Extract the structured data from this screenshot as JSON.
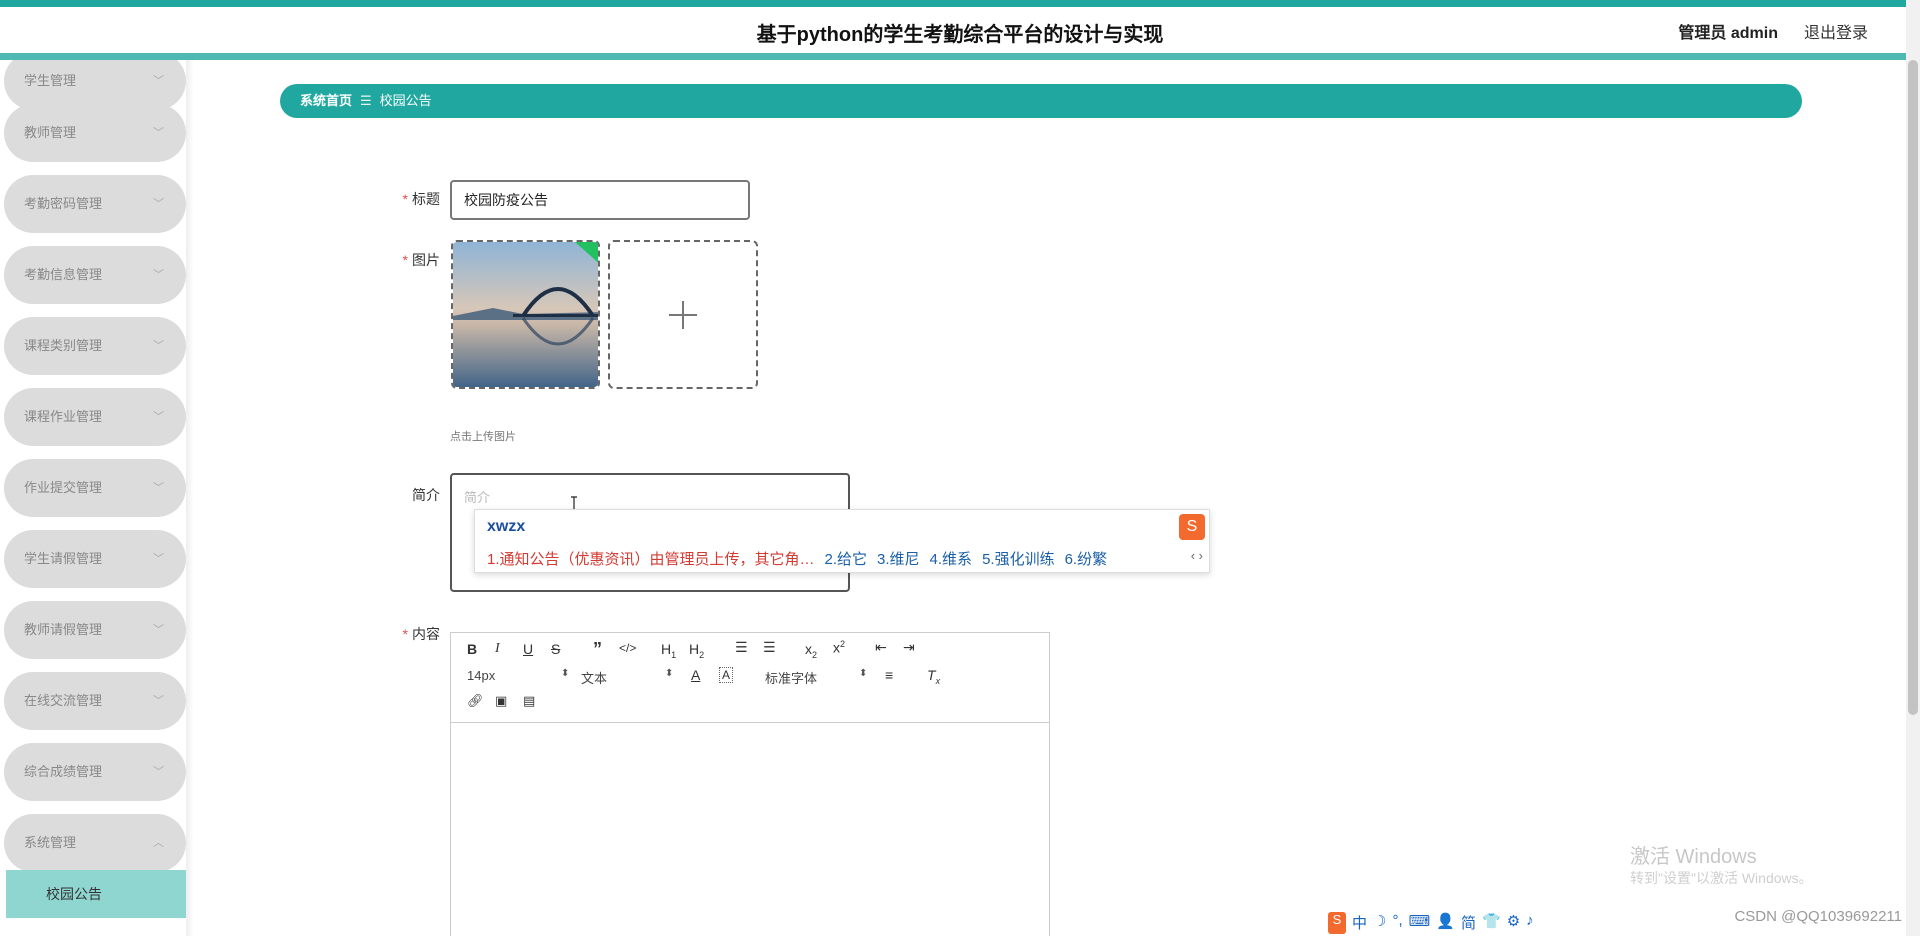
{
  "header": {
    "title": "基于python的学生考勤综合平台的设计与实现",
    "user": "管理员 admin",
    "logout": "退出登录"
  },
  "sidebar": {
    "items": [
      {
        "label": "学生管理"
      },
      {
        "label": "教师管理"
      },
      {
        "label": "考勤密码管理"
      },
      {
        "label": "考勤信息管理"
      },
      {
        "label": "课程类别管理"
      },
      {
        "label": "课程作业管理"
      },
      {
        "label": "作业提交管理"
      },
      {
        "label": "学生请假管理"
      },
      {
        "label": "教师请假管理"
      },
      {
        "label": "在线交流管理"
      },
      {
        "label": "综合成绩管理"
      },
      {
        "label": "系统管理"
      }
    ],
    "active_sub": "校园公告"
  },
  "breadcrumb": {
    "home": "系统首页",
    "sep": "☰",
    "current": "校园公告"
  },
  "form": {
    "title_label": "标题",
    "title_value": "校园防疫公告",
    "image_label": "图片",
    "upload_hint": "点击上传图片",
    "intro_label": "简介",
    "intro_placeholder": "简介",
    "content_label": "内容"
  },
  "ime": {
    "input": "xwzx",
    "candidates": [
      "1.通知公告（优惠资讯）由管理员上传，其它角…",
      "2.给它",
      "3.维尼",
      "4.维系",
      "5.强化训练",
      "6.纷繁"
    ],
    "arrows": "‹ ›"
  },
  "editor": {
    "font_size": "14px",
    "text_type": "文本",
    "font_family": "标准字体"
  },
  "watermark": {
    "line1": "激活 Windows",
    "line2": "转到\"设置\"以激活 Windows。",
    "csdn": "CSDN @QQ1039692211"
  },
  "tray": [
    "中",
    "☽",
    "°,",
    "⌨",
    "👤",
    "简",
    "👕",
    "⚙",
    "♪"
  ]
}
